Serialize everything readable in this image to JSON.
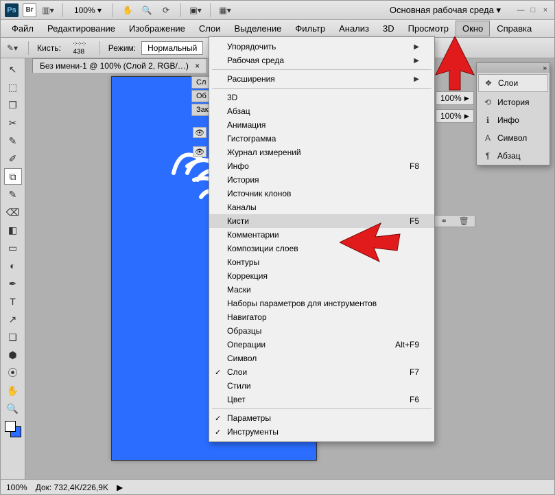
{
  "topbar": {
    "ps": "Ps",
    "br": "Br",
    "zoom": "100% ▾",
    "workspace": "Основная рабочая среда ▾"
  },
  "menubar": {
    "items": [
      "Файл",
      "Редактирование",
      "Изображение",
      "Слои",
      "Выделение",
      "Фильтр",
      "Анализ",
      "3D",
      "Просмотр",
      "Окно",
      "Справка"
    ],
    "active": "Окно"
  },
  "options": {
    "brush_label": "Кисть:",
    "brush_size": "438",
    "mode_label": "Режим:",
    "mode_value": "Нормальный"
  },
  "document": {
    "tab": "Без имени-1 @ 100% (Слой 2, RGB/…)",
    "close": "×"
  },
  "dropdown": {
    "groups": [
      {
        "items": [
          {
            "label": "Упорядочить",
            "sub": true
          },
          {
            "label": "Рабочая среда",
            "sub": true
          }
        ]
      },
      {
        "items": [
          {
            "label": "Расширения",
            "sub": true
          }
        ]
      },
      {
        "items": [
          {
            "label": "3D"
          },
          {
            "label": "Абзац"
          },
          {
            "label": "Анимация"
          },
          {
            "label": "Гистограмма"
          },
          {
            "label": "Журнал измерений"
          },
          {
            "label": "Инфо",
            "kb": "F8"
          },
          {
            "label": "История"
          },
          {
            "label": "Источник клонов"
          },
          {
            "label": "Каналы"
          },
          {
            "label": "Кисти",
            "kb": "F5",
            "hover": true
          },
          {
            "label": "Комментарии"
          },
          {
            "label": "Композиции слоев"
          },
          {
            "label": "Контуры"
          },
          {
            "label": "Коррекция"
          },
          {
            "label": "Маски"
          },
          {
            "label": "Наборы параметров для инструментов"
          },
          {
            "label": "Навигатор"
          },
          {
            "label": "Образцы"
          },
          {
            "label": "Операции",
            "kb": "Alt+F9"
          },
          {
            "label": "Символ"
          },
          {
            "label": "Слои",
            "kb": "F7",
            "check": true
          },
          {
            "label": "Стили"
          },
          {
            "label": "Цвет",
            "kb": "F6"
          }
        ]
      },
      {
        "items": [
          {
            "label": "Параметры",
            "check": true
          },
          {
            "label": "Инструменты",
            "check": true
          }
        ]
      }
    ]
  },
  "percent1": "100%",
  "percent2": "100%",
  "floatpanel": {
    "items": [
      {
        "icon": "layers",
        "label": "Слои",
        "active": true
      },
      {
        "icon": "history",
        "label": "История"
      },
      {
        "icon": "info",
        "label": "Инфо"
      },
      {
        "icon": "char",
        "label": "Символ"
      },
      {
        "icon": "para",
        "label": "Абзац"
      }
    ]
  },
  "mini_tabs": [
    "Сл",
    "Об",
    "Зак"
  ],
  "status": {
    "zoom": "100%",
    "doc": "Док: 732,4K/226,9K"
  },
  "toolbox_icons": [
    "↖",
    "⬚",
    "❐",
    "✂",
    "✎",
    "✐",
    "⧉",
    "✎",
    "⌫",
    "◧",
    "▭",
    "◐",
    "T",
    "↗",
    "❏",
    "✋",
    "🔍"
  ]
}
